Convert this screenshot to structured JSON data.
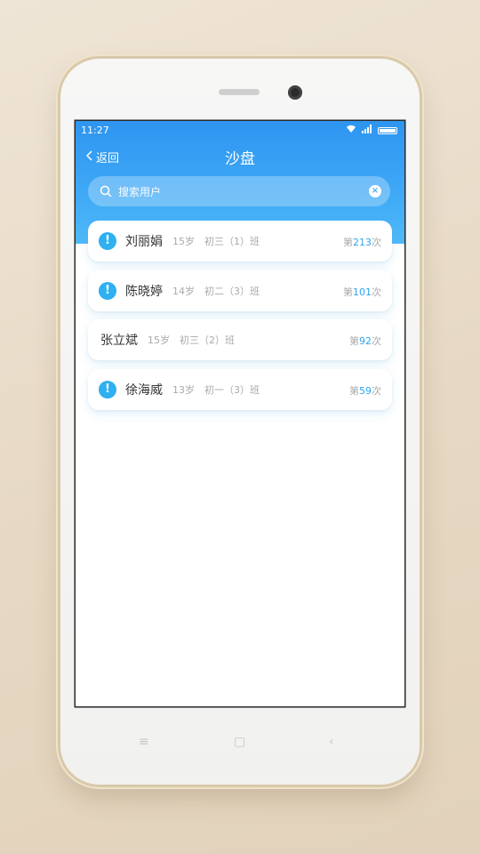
{
  "status": {
    "time": "11:27"
  },
  "nav": {
    "back_label": "返回",
    "title": "沙盘"
  },
  "search": {
    "placeholder": "搜索用户"
  },
  "users": [
    {
      "name": "刘丽娟",
      "age": "15岁",
      "class": "初三（1）班",
      "count_prefix": "第",
      "count": "213",
      "count_suffix": "次",
      "alert": true
    },
    {
      "name": "陈晓婷",
      "age": "14岁",
      "class": "初二（3）班",
      "count_prefix": "第",
      "count": "101",
      "count_suffix": "次",
      "alert": true
    },
    {
      "name": "张立斌",
      "age": "15岁",
      "class": "初三（2）班",
      "count_prefix": "第",
      "count": "92",
      "count_suffix": "次",
      "alert": false
    },
    {
      "name": "徐海威",
      "age": "13岁",
      "class": "初一（3）班",
      "count_prefix": "第",
      "count": "59",
      "count_suffix": "次",
      "alert": true
    }
  ],
  "colors": {
    "header": "#3fa9f6",
    "accent": "#2fb0f0",
    "count": "#2fa4ee"
  },
  "icons": {
    "alert": "exclamation-icon",
    "search": "search-icon",
    "clear": "clear-icon",
    "back": "chevron-left-icon"
  }
}
